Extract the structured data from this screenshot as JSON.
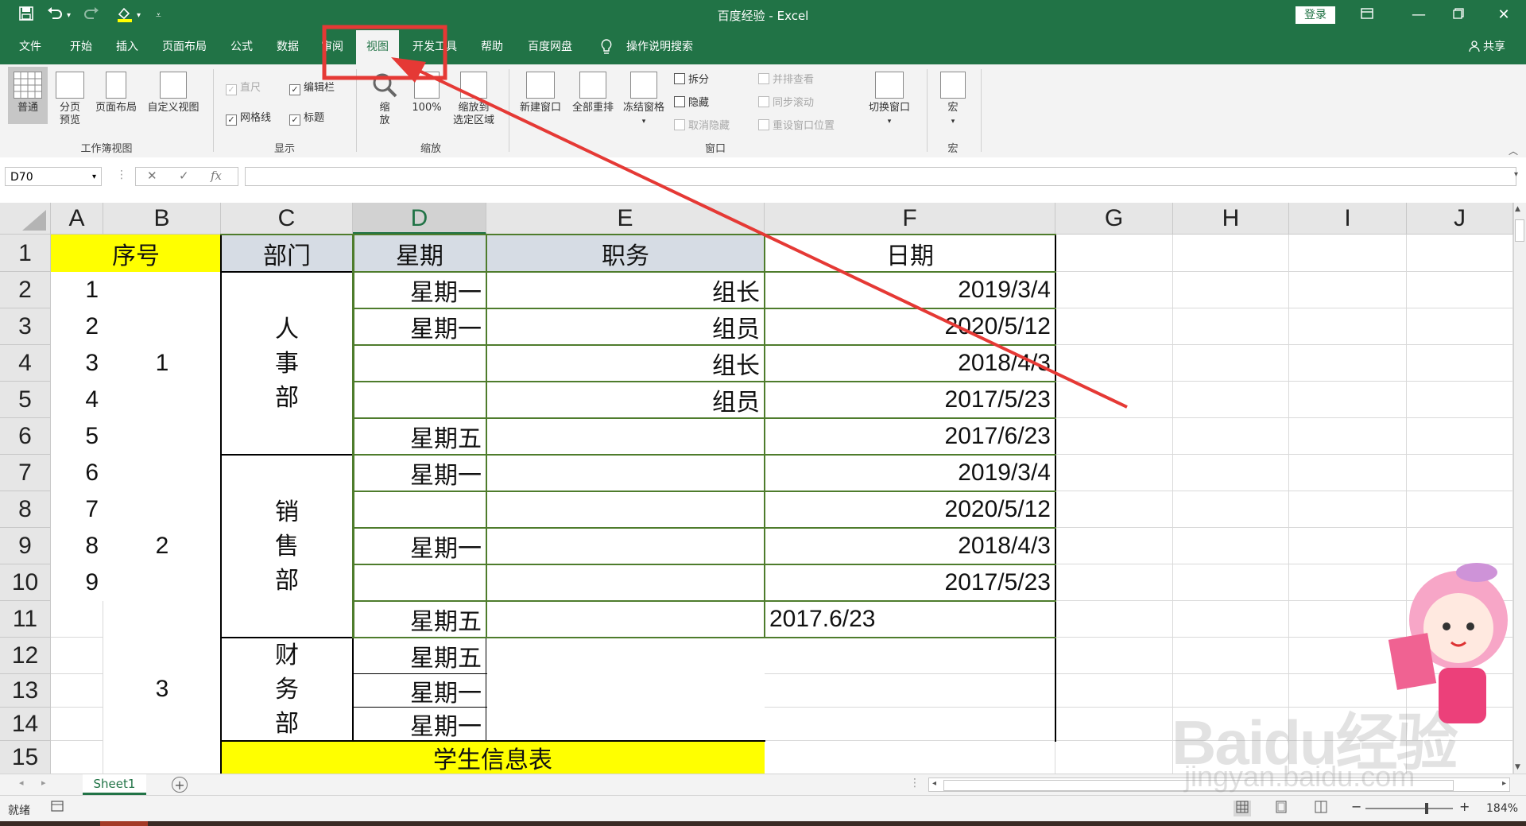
{
  "window": {
    "title": "百度经验  -  Excel",
    "login_label": "登录",
    "qa_save_icon": "save-icon",
    "qa_undo_icon": "undo-icon",
    "qa_redo_icon": "redo-icon",
    "qa_fill_icon": "fill-color-icon"
  },
  "menu": {
    "tabs": [
      "文件",
      "开始",
      "插入",
      "页面布局",
      "公式",
      "数据",
      "审阅",
      "视图",
      "开发工具",
      "帮助",
      "百度网盘",
      "操作说明搜索"
    ],
    "active_tab": "视图",
    "share_label": "共享"
  },
  "ribbon": {
    "workbook_views": {
      "label": "工作簿视图",
      "normal": "普通",
      "page_break_1": "分页",
      "page_break_2": "预览",
      "page_layout": "页面布局",
      "custom_view": "自定义视图"
    },
    "show": {
      "label": "显示",
      "ruler": "直尺",
      "formula_bar": "编辑栏",
      "gridlines": "网格线",
      "headings": "标题"
    },
    "zoom": {
      "label": "缩放",
      "zoom_1": "缩",
      "zoom_2": "放",
      "zoom_100": "100%",
      "zoom_sel_1": "缩放到",
      "zoom_sel_2": "选定区域"
    },
    "window": {
      "label": "窗口",
      "new_window": "新建窗口",
      "arrange_all": "全部重排",
      "freeze_panes": "冻结窗格",
      "split": "拆分",
      "hide": "隐藏",
      "unhide": "取消隐藏",
      "side_by_side": "并排查看",
      "sync_scroll": "同步滚动",
      "reset_pos": "重设窗口位置",
      "switch_windows": "切换窗口"
    },
    "macros": {
      "label": "宏",
      "macro": "宏"
    }
  },
  "formula_bar": {
    "name_box": "D70",
    "fx_label": "fx",
    "value": ""
  },
  "sheet": {
    "columns": [
      "A",
      "B",
      "C",
      "D",
      "E",
      "F",
      "G",
      "H",
      "I",
      "J"
    ],
    "selected_column": "D",
    "rows": [
      "1",
      "2",
      "3",
      "4",
      "5",
      "6",
      "7",
      "8",
      "9",
      "10",
      "11",
      "12",
      "13",
      "14",
      "15"
    ],
    "header": {
      "B": "序号",
      "C": "部门",
      "D": "星期",
      "E": "职务",
      "F": "日期"
    },
    "col_a": [
      "1",
      "2",
      "3",
      "4",
      "5",
      "6",
      "7",
      "8",
      "9"
    ],
    "col_b_merged": [
      "1",
      "2",
      "3"
    ],
    "departments": [
      {
        "chars": [
          "人",
          "事",
          "部"
        ]
      },
      {
        "chars": [
          "销",
          "售",
          "部"
        ]
      },
      {
        "chars": [
          "财",
          "务",
          "部"
        ]
      }
    ],
    "col_d": [
      "星期一",
      "星期一",
      "",
      "",
      "星期五",
      "星期一",
      "",
      "星期一",
      "",
      "星期五",
      "星期五",
      "星期一",
      "星期一"
    ],
    "col_e": [
      "组长",
      "组员",
      "组长",
      "组员"
    ],
    "col_f": [
      "2019/3/4",
      "2020/5/12",
      "2018/4/3",
      "2017/5/23",
      "2017/6/23",
      "2019/3/4",
      "2020/5/12",
      "2018/4/3",
      "2017/5/23"
    ],
    "f11_text": "2017.6/23",
    "footer_title": "学生信息表",
    "highlight_color": "#ffff00",
    "header_fill": "#d6dce4"
  },
  "sheet_tabs": {
    "active": "Sheet1",
    "add_icon": "add-sheet-icon"
  },
  "status": {
    "ready": "就绪",
    "zoom": "184%"
  },
  "watermark": {
    "brand": "Baidu经验",
    "url": "jingyan.baidu.com"
  },
  "annotation": {
    "color": "#e53935"
  }
}
